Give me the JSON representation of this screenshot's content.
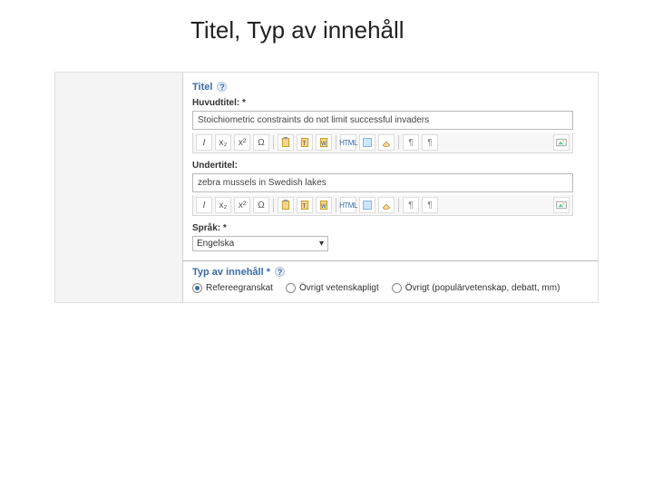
{
  "slide": {
    "title": "Titel, Typ av innehåll"
  },
  "titleSection": {
    "heading": "Titel",
    "mainLabel": "Huvudtitel: *",
    "mainValue": "Stoichiometric constraints do not limit successful invaders",
    "subLabel": "Undertitel:",
    "subValue": "zebra mussels in Swedish lakes",
    "langLabel": "Språk: *",
    "langValue": "Engelska"
  },
  "toolbar": {
    "italic": "I",
    "sub": "x₂",
    "sup": "x²",
    "omega": "Ω",
    "html": "HTML"
  },
  "typeSection": {
    "heading": "Typ av innehåll *",
    "options": [
      {
        "label": "Refereegranskat",
        "checked": true
      },
      {
        "label": "Övrigt vetenskapligt",
        "checked": false
      },
      {
        "label": "Övrigt (populärvetenskap, debatt, mm)",
        "checked": false
      }
    ]
  }
}
